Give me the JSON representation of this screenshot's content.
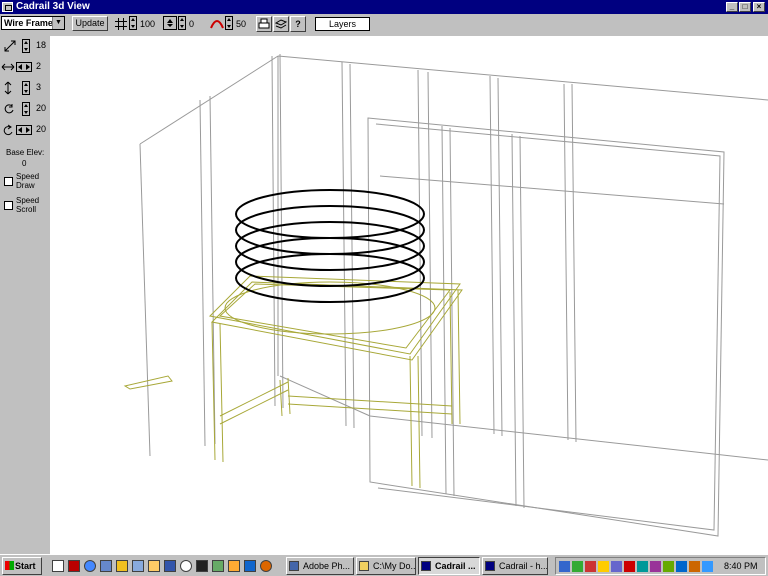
{
  "window": {
    "title": "Cadrail 3d View"
  },
  "toolbar": {
    "view_mode": "Wire Frame",
    "update_label": "Update",
    "grid_value": "100",
    "offset_value": "0",
    "curve_value": "50",
    "layers_label": "Layers",
    "help_label": "?"
  },
  "left_panel": {
    "zoom_value": "18",
    "pan_h_value": "2",
    "pan_v_value": "3",
    "rotate_value": "20",
    "tilt_value": "20",
    "base_elev_label": "Base Elev:",
    "base_elev_value": "0",
    "speed_draw_label_1": "Speed",
    "speed_draw_label_2": "Draw",
    "speed_scroll_label_1": "Speed",
    "speed_scroll_label_2": "Scroll"
  },
  "taskbar": {
    "start_label": "Start",
    "tasks": [
      {
        "label": "Adobe Ph...",
        "active": false
      },
      {
        "label": "C:\\My Do...",
        "active": false
      },
      {
        "label": "Cadrail ...",
        "active": true
      },
      {
        "label": "Cadrail - h...",
        "active": false
      }
    ],
    "clock": "8:40 PM"
  },
  "colors": {
    "title_bar": "#000080",
    "chrome": "#c0c0c0",
    "wall_lines": "#999999",
    "table_lines": "#a8a838",
    "helix": "#000000"
  },
  "icons": {
    "app": "app-icon",
    "grid": "grid-icon",
    "offset": "offset-icon",
    "curve": "curve-icon",
    "print": "print-icon",
    "layers_stack": "layers-stack-icon"
  }
}
